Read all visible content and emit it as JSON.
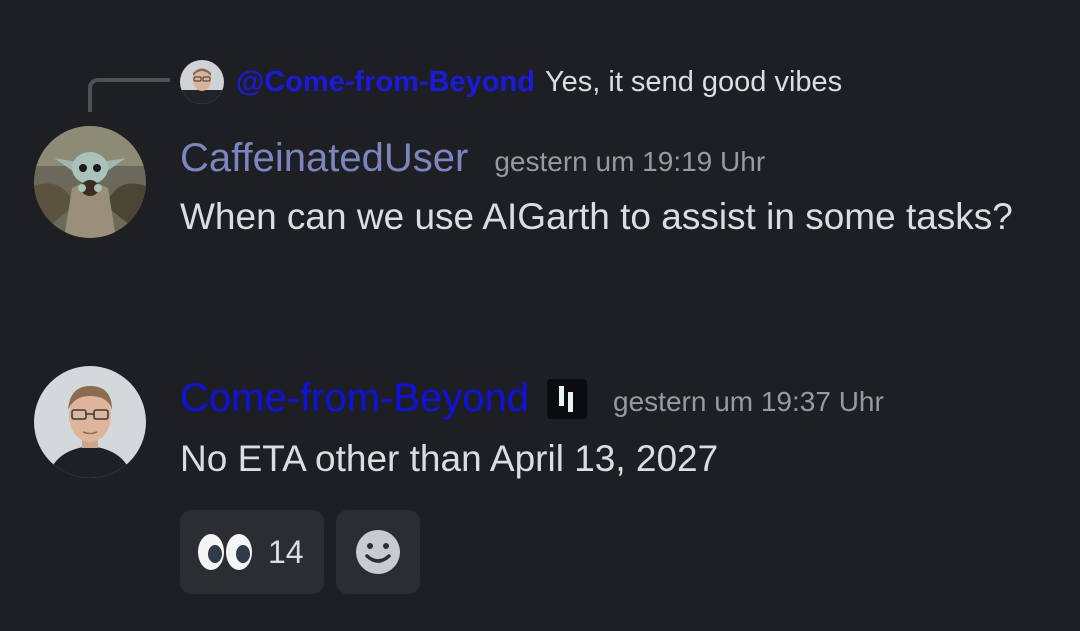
{
  "reply": {
    "mention": "@Come-from-Beyond",
    "text": "Yes, it send good vibes"
  },
  "messages": [
    {
      "username": "CaffeinatedUser",
      "username_color": "#7b86c1",
      "timestamp": "gestern um 19:19 Uhr",
      "text": "When can we use AIGarth to assist in some tasks?"
    },
    {
      "username": "Come-from-Beyond",
      "username_color": "#1010e0",
      "timestamp": "gestern um 19:37 Uhr",
      "text": "No ETA other than April 13, 2027",
      "badge_icon": "role-badge-icon"
    }
  ],
  "reactions": [
    {
      "emoji_icon": "eyes-emoji-icon",
      "count": "14"
    }
  ],
  "add_reaction_icon": "smiley-icon",
  "colors": {
    "background": "#1e1f23",
    "text": "#dbdee1",
    "muted": "#949ba4",
    "reaction_bg": "#2b2d33",
    "mention": "#1a1adf"
  }
}
